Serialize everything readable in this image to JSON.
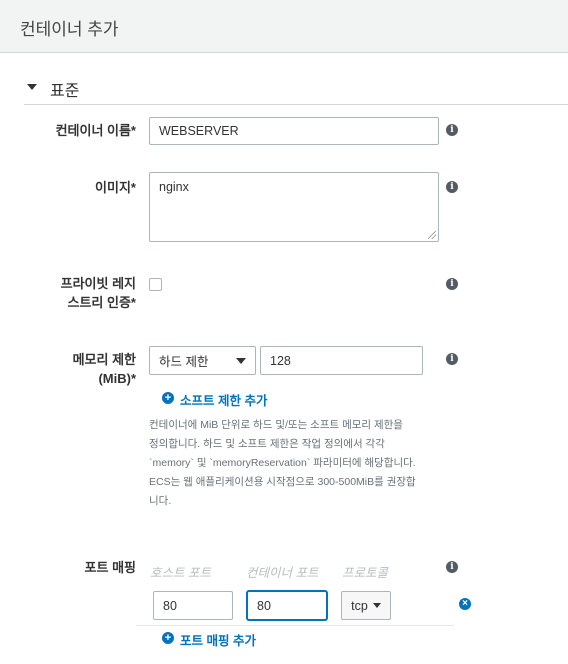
{
  "header": {
    "title": "컨테이너 추가"
  },
  "section": {
    "title": "표준"
  },
  "container_name": {
    "label": "컨테이너 이름*",
    "value": "WEBSERVER"
  },
  "image": {
    "label": "이미지*",
    "value": "nginx"
  },
  "private_registry": {
    "label_line1": "프라이빗 레지",
    "label_line2": "스트리 인증*",
    "checked": false
  },
  "memory": {
    "label_line1": "메모리 제한",
    "label_line2": "(MiB)*",
    "limit_type": "하드 제한",
    "value": "128",
    "add_soft_limit": "소프트 제한 추가",
    "help_lines": [
      "컨테이너에 MiB 단위로 하드 및/또는 소프트 메모리 제한을",
      "정의합니다. 하드 및 소프트 제한은 작업 정의에서 각각",
      "`memory` 및 `memoryReservation` 파라미터에 해당합니다.",
      "ECS는 웹 애플리케이션용 시작점으로 300-500MiB를 권장합",
      "니다."
    ]
  },
  "port_mapping": {
    "label": "포트 매핑",
    "col_host": "호스트 포트",
    "col_container": "컨테이너 포트",
    "col_protocol": "프로토콜",
    "host_port": "80",
    "container_port": "80",
    "protocol": "tcp",
    "add_label": "포트 매핑 추가"
  },
  "icons": {
    "info": "info-icon",
    "add": "plus-circle-icon",
    "remove": "x-circle-icon",
    "collapse": "caret-down-icon"
  }
}
